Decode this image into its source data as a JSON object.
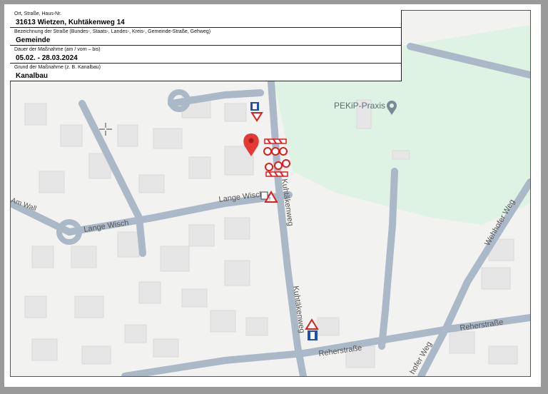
{
  "form": {
    "fields": [
      {
        "label": "Ort, Straße, Haus-Nr.",
        "value": "31613 Wietzen, Kuhtäkenweg 14"
      },
      {
        "label": "Bezeichnung der Straße (Bundes-, Staats-, Landes-, Kreis-, Gemeinde-Straße, Gehweg)",
        "value": "Gemeinde"
      },
      {
        "label": "Dauer der Maßnahme (am / vom – bis)",
        "value": "05.02. - 28.03.2024"
      },
      {
        "label": "Grund der Maßnahme (z. B. Kanalbau)",
        "value": "Kanalbau"
      }
    ]
  },
  "map": {
    "poi_label": "PEKiP-Praxis",
    "streets": {
      "lange_wisch_1": "Lange Wisch",
      "lange_wisch_2": "Lange Wisch",
      "am_wall": "Am Wall",
      "kuhtakenweg_1": "Kuhtäkenweg",
      "kuhtakenweg_2": "Kuhtäkenweg",
      "reherstrasse_1": "Reherstraße",
      "reherstrasse_2": "Reherstraße",
      "wehhofer_weg_1": "Wehhofer Weg",
      "wehhofer_weg_2": "hofer Weg"
    },
    "colors": {
      "land": "#f2f2f0",
      "park": "#dff3e4",
      "road": "#aab8c8",
      "building": "#e6e6e6",
      "pin": "#e53935",
      "sign_red": "#e21b1b",
      "sign_blue": "#1e4fb5"
    },
    "icons": [
      "map-pin-icon",
      "poi-pin-icon",
      "crosshair-icon",
      "road-closed-sign-icon",
      "construction-sign-icon",
      "detour-sign-icon"
    ]
  }
}
